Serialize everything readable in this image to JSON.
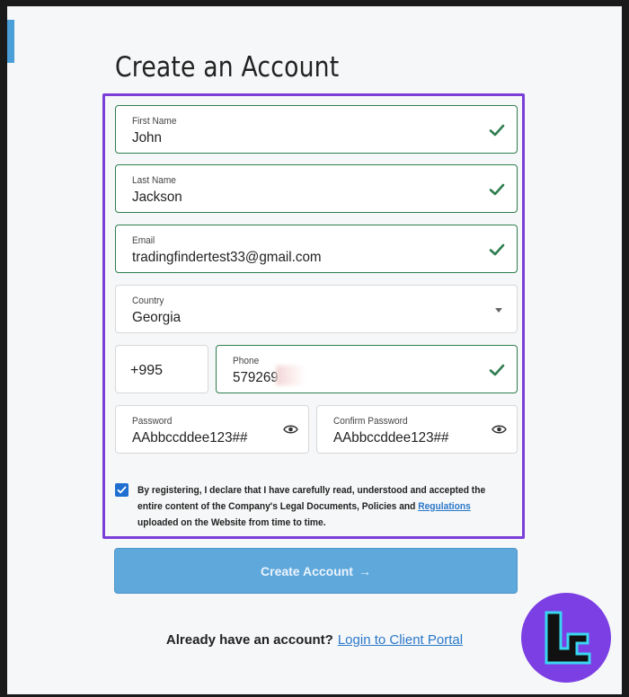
{
  "title": "Create an Account",
  "fields": {
    "first_name": {
      "label": "First Name",
      "value": "John"
    },
    "last_name": {
      "label": "Last Name",
      "value": "Jackson"
    },
    "email": {
      "label": "Email",
      "value": "tradingfindertest33@gmail.com"
    },
    "country": {
      "label": "Country",
      "value": "Georgia"
    },
    "phone_code": {
      "value": "+995"
    },
    "phone": {
      "label": "Phone",
      "value": "579269"
    },
    "password": {
      "label": "Password",
      "value": "AAbbccddee123##"
    },
    "confirm_password": {
      "label": "Confirm Password",
      "value": "AAbbccddee123##"
    }
  },
  "consent": {
    "checked": true,
    "text_before": "By registering, I declare that I have carefully read, understood and accepted the entire content of the Company's Legal Documents, Policies and ",
    "link_text": "Regulations",
    "text_after": " uploaded on the Website from time to time."
  },
  "submit": {
    "label": "Create Account",
    "arrow": "→"
  },
  "login": {
    "question": "Already have an account?",
    "link_text": "Login to Client Portal"
  },
  "colors": {
    "accent": "#7a3fd8",
    "valid": "#2e7d4f",
    "button": "#5fa8dc",
    "link": "#2a78c9",
    "checkbox": "#1f6fd1"
  },
  "icons": [
    "check-icon",
    "eye-icon",
    "chevron-down-icon",
    "arrow-right-icon",
    "brand-logo"
  ]
}
